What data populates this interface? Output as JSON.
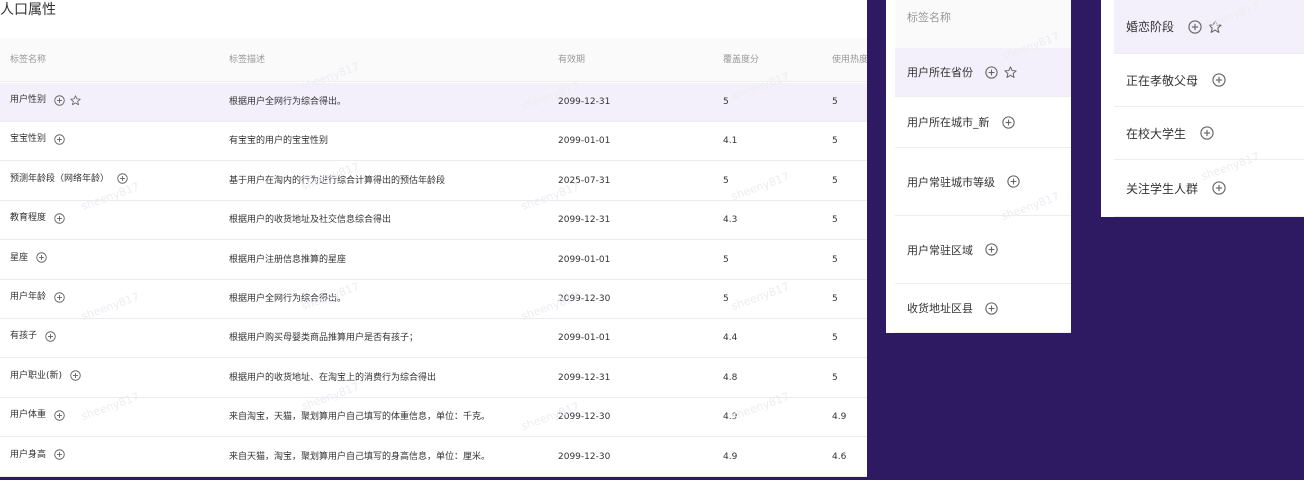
{
  "main": {
    "section_title": "人口属性",
    "headers": [
      "标签名称",
      "标签描述",
      "有效期",
      "覆盖度分",
      "使用热度"
    ],
    "rows": [
      {
        "name": "用户性别",
        "desc": "根据用户全网行为综合得出。",
        "date": "2099-12-31",
        "coverage": "5",
        "heat": "5",
        "star": true,
        "highlight": true
      },
      {
        "name": "宝宝性别",
        "desc": "有宝宝的用户的宝宝性别",
        "date": "2099-01-01",
        "coverage": "4.1",
        "heat": "5",
        "star": false
      },
      {
        "name": "预测年龄段（网络年龄）",
        "desc": "基于用户在淘内的行为进行综合计算得出的预估年龄段",
        "date": "2025-07-31",
        "coverage": "5",
        "heat": "5",
        "star": false
      },
      {
        "name": "教育程度",
        "desc": "根据用户的收货地址及社交信息综合得出",
        "date": "2099-12-31",
        "coverage": "4.3",
        "heat": "5",
        "star": false
      },
      {
        "name": "星座",
        "desc": "根据用户注册信息推算的星座",
        "date": "2099-01-01",
        "coverage": "5",
        "heat": "5",
        "star": false
      },
      {
        "name": "用户年龄",
        "desc": "根据用户全网行为综合得出。",
        "date": "2099-12-30",
        "coverage": "5",
        "heat": "5",
        "star": false
      },
      {
        "name": "有孩子",
        "desc": "根据用户购买母婴类商品推算用户是否有孩子；",
        "date": "2099-01-01",
        "coverage": "4.4",
        "heat": "5",
        "star": false
      },
      {
        "name": "用户职业(新)",
        "desc": "根据用户的收货地址、在淘宝上的消费行为综合得出",
        "date": "2099-12-31",
        "coverage": "4.8",
        "heat": "5",
        "star": false
      },
      {
        "name": "用户体重",
        "desc": "来自淘宝，天猫，聚划算用户自己填写的体重信息，单位：千克。",
        "date": "2099-12-30",
        "coverage": "4.9",
        "heat": "4.9",
        "star": false
      },
      {
        "name": "用户身高",
        "desc": "来自天猫，淘宝，聚划算用户自己填写的身高信息，单位：厘米。",
        "date": "2099-12-30",
        "coverage": "4.9",
        "heat": "4.6",
        "star": false
      }
    ]
  },
  "mid": {
    "header": "标签名称",
    "items": [
      {
        "name": "用户所在省份",
        "star": true,
        "highlight": true
      },
      {
        "name": "用户所在城市_新",
        "star": false
      },
      {
        "name": "用户常驻城市等级",
        "star": false
      },
      {
        "name": "用户常驻区域",
        "star": false
      },
      {
        "name": "收货地址区县",
        "star": false
      }
    ]
  },
  "right": {
    "items": [
      {
        "name": "婚恋阶段",
        "star": true,
        "highlight": true
      },
      {
        "name": "正在孝敬父母",
        "star": false
      },
      {
        "name": "在校大学生",
        "star": false
      },
      {
        "name": "关注学生人群",
        "star": false
      }
    ]
  },
  "watermark": "sheeny817",
  "colors": {
    "background": "#2d1a63",
    "highlight_row": "#f4f0fb",
    "icon": "#666666"
  }
}
